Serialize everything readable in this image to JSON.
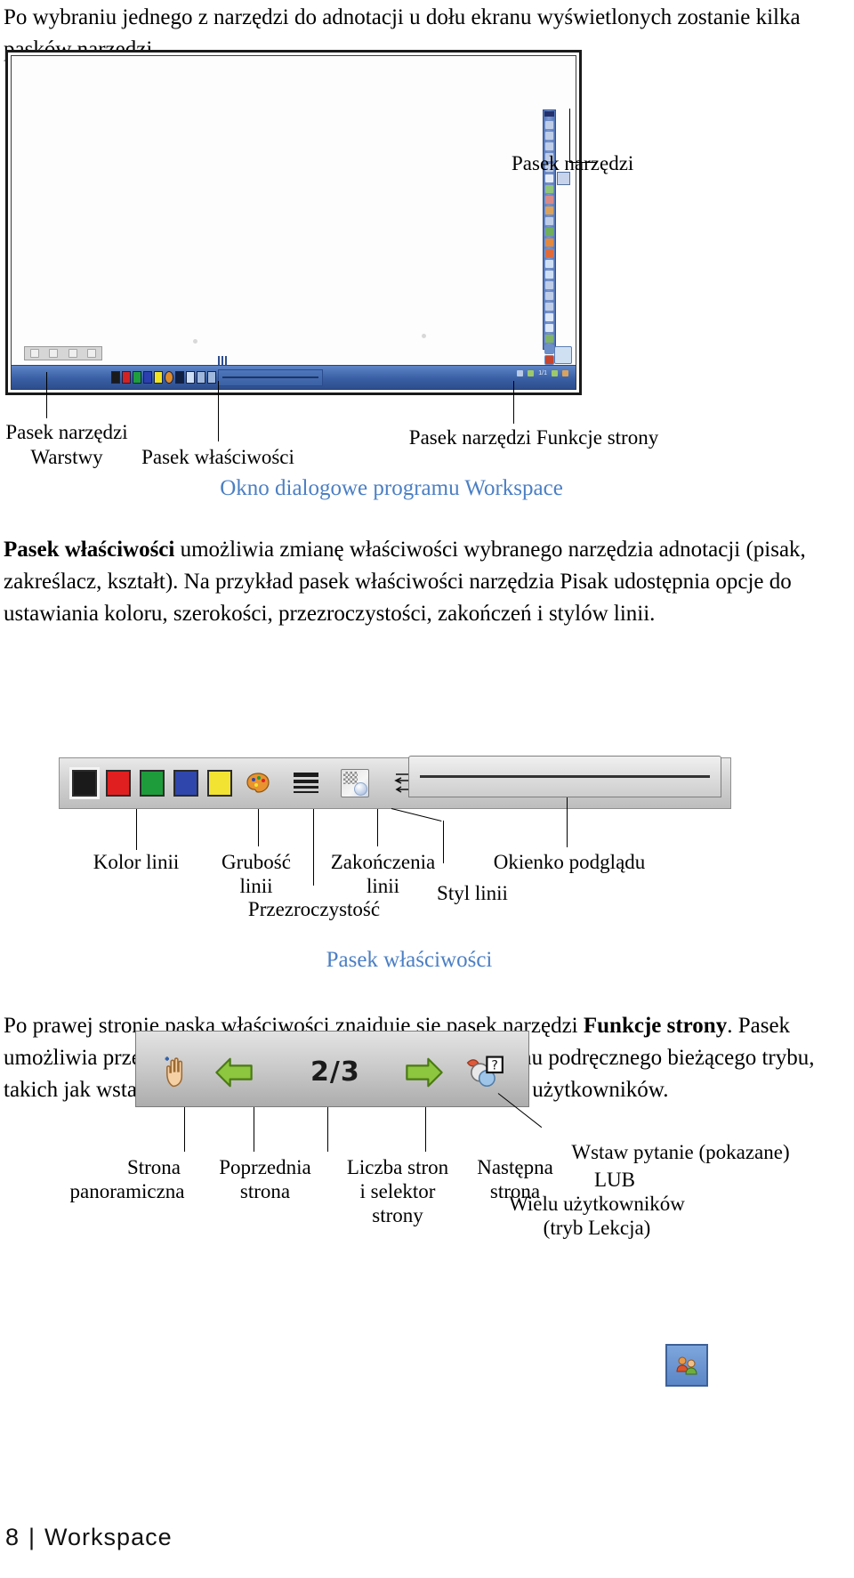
{
  "document": {
    "intro_paragraph": "Po wybraniu jednego z narzędzi do adnotacji u dołu ekranu wyświetlonych zostanie kilka pasków narzędzi.",
    "footer_page_number": "8",
    "footer_separator": "|",
    "footer_title": "Workspace"
  },
  "screenshot_callouts": {
    "toolbar_right": "Pasek narzędzi",
    "toolbar_layers_line1": "Pasek narzędzi",
    "toolbar_layers_line2": "Warstwy",
    "properties_bar": "Pasek właściwości",
    "page_functions_bar": "Pasek narzędzi Funkcje strony",
    "figure_caption": "Okno dialogowe programu Workspace"
  },
  "screenshot_ui": {
    "swatch_colors": [
      "#1a1a1a",
      "#d32222",
      "#1f9e3d",
      "#2b3fb0",
      "#f1e321",
      "#e08b2a"
    ],
    "page_indicator": "1/1"
  },
  "properties_section": {
    "paragraph_plain_1": " umożliwia zmianę właściwości wybranego narzędzia adnotacji (pisak, zakreślacz, kształt). Na przykład pasek właściwości narzędzia Pisak udostępnia opcje do ustawiania koloru, szerokości, przezroczystości, zakończeń i stylów linii.",
    "paragraph_bold_1": "Pasek właściwości",
    "toolbar": {
      "swatches": [
        {
          "name": "black",
          "color": "#1a1a1a",
          "selected": true
        },
        {
          "name": "red",
          "color": "#e02020",
          "selected": false
        },
        {
          "name": "green",
          "color": "#1e9c3c",
          "selected": false
        },
        {
          "name": "blue",
          "color": "#2f47ad",
          "selected": false
        },
        {
          "name": "yellow",
          "color": "#f2e333",
          "selected": false
        }
      ],
      "palette_icon": "palette-icon",
      "thickness_icon": "line-thickness-icon",
      "transparency_icon": "transparency-icon",
      "line_ends_icon": "line-ends-icon",
      "line_style_icon": "line-style-icon",
      "preview_label": "line-preview"
    },
    "labels": {
      "line_color": "Kolor linii",
      "line_thickness_1": "Grubość",
      "line_thickness_2": "linii",
      "transparency": "Przezroczystość",
      "line_ends_1": "Zakończenia",
      "line_ends_2": "linii",
      "line_style": "Styl linii",
      "preview_window": "Okienko podglądu"
    },
    "caption": "Pasek właściwości"
  },
  "page_functions_section": {
    "paragraph_plain_1": "Po prawej stronie paska właściwości znajduje się pasek narzędzi ",
    "paragraph_bold_1": "Funkcje",
    "paragraph_bold_2": "strony",
    "paragraph_plain_2": ". Pasek umożliwia przewijanie stron i uzyskiwanie dostępu do menu podręcznego bieżącego trybu, takich jak wstawianie pytania lub konfiguracja trybu wielu użytkowników.",
    "toolbar": {
      "pan_icon": "pan-hand-icon",
      "prev_icon": "arrow-left-icon",
      "page_count": "2/3",
      "next_icon": "arrow-right-icon",
      "question_icon": "insert-question-icon"
    },
    "labels": {
      "pan_page_1": "Strona",
      "pan_page_2": "panoramiczna",
      "prev_page_1": "Poprzednia",
      "prev_page_2": "strona",
      "page_count_1": "Liczba stron",
      "page_count_2": "i selektor",
      "page_count_3": "strony",
      "next_page_1": "Następna",
      "next_page_2": "strona",
      "insert_question_1": "Wstaw pytanie (pokazane)",
      "insert_question_2": "LUB",
      "insert_question_3": "Wielu użytkowników",
      "insert_question_4": "(tryb Lekcja)"
    },
    "multi_user_icon": "multi-user-icon"
  }
}
